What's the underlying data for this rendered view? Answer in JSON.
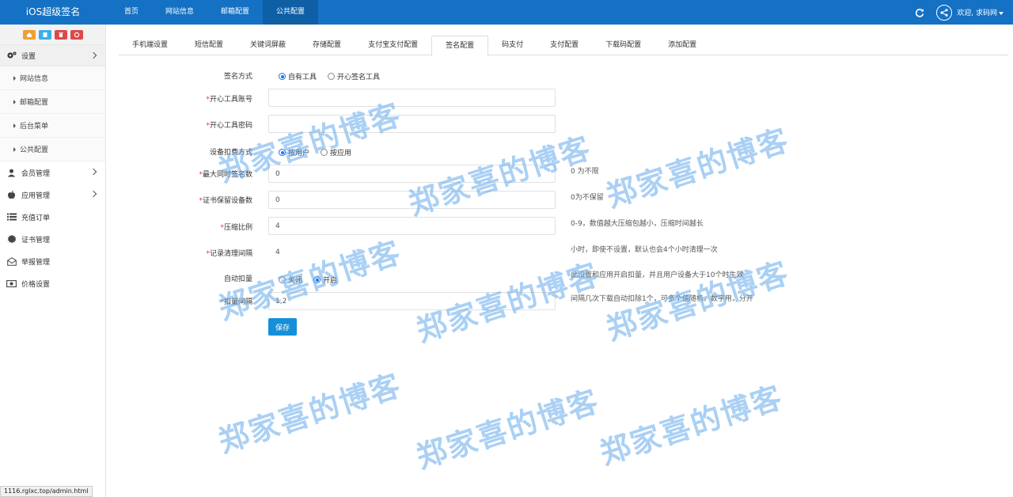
{
  "brand": "iOS超级签名",
  "topnav": [
    {
      "label": "首页"
    },
    {
      "label": "网站信息"
    },
    {
      "label": "邮箱配置"
    },
    {
      "label": "公共配置"
    }
  ],
  "user": {
    "welcome": "欢迎, 求码网"
  },
  "sidebar": {
    "settings": "设置",
    "sub_items": [
      {
        "label": "网站信息"
      },
      {
        "label": "邮箱配置"
      },
      {
        "label": "后台菜单"
      },
      {
        "label": "公共配置"
      }
    ],
    "items": [
      {
        "label": "会员管理",
        "icon": "user-icon"
      },
      {
        "label": "应用管理",
        "icon": "apple-icon"
      },
      {
        "label": "充值订单",
        "icon": "list-icon"
      },
      {
        "label": "证书管理",
        "icon": "cert-icon"
      },
      {
        "label": "举报管理",
        "icon": "mail-icon"
      },
      {
        "label": "价格设置",
        "icon": "money-icon"
      }
    ],
    "tool_colors": [
      "#f0a030",
      "#3ab0e8",
      "#e04848",
      "#e04848"
    ]
  },
  "tabs": [
    {
      "label": "手机端设置"
    },
    {
      "label": "短信配置"
    },
    {
      "label": "关键词屏蔽"
    },
    {
      "label": "存储配置"
    },
    {
      "label": "支付宝支付配置"
    },
    {
      "label": "签名配置"
    },
    {
      "label": "码支付"
    },
    {
      "label": "支付配置"
    },
    {
      "label": "下载码配置"
    },
    {
      "label": "添加配置"
    }
  ],
  "form": {
    "sign_method": {
      "label": "签名方式",
      "options": [
        "自有工具",
        "开心签名工具"
      ]
    },
    "kx_account": {
      "label": "开心工具账号",
      "value": ""
    },
    "kx_password": {
      "label": "开心工具密码",
      "value": ""
    },
    "deduct_method": {
      "label": "设备扣费方式",
      "options": [
        "按用户",
        "按应用"
      ]
    },
    "max_sign": {
      "label": "最大同时签名数",
      "value": "0",
      "hint": "0 为不限"
    },
    "cert_keep": {
      "label": "证书保留设备数",
      "value": "0",
      "hint": "0为不保留"
    },
    "compress": {
      "label": "压缩比例",
      "value": "4",
      "hint": "0-9，数值越大压缩包越小，压缩时间越长"
    },
    "cleanup": {
      "label": "记录清理间隔",
      "value": "4",
      "hint": "小时，即使不设置，默认也会4个小时清理一次"
    },
    "auto_deduct": {
      "label": "自动扣量",
      "options": [
        "关闭",
        "开启"
      ],
      "hint": "此设置和应用开启扣量，并且用户设备大于10个时生效"
    },
    "deduct_interval": {
      "label": "扣量间隔",
      "value": "1,2",
      "hint": "间隔几次下载自动扣除1个，可多个值随机，数字用，分开"
    },
    "save": "保存"
  },
  "watermark": "郑家喜的博客",
  "status_url": "1116.rglxc.top/admin.html"
}
